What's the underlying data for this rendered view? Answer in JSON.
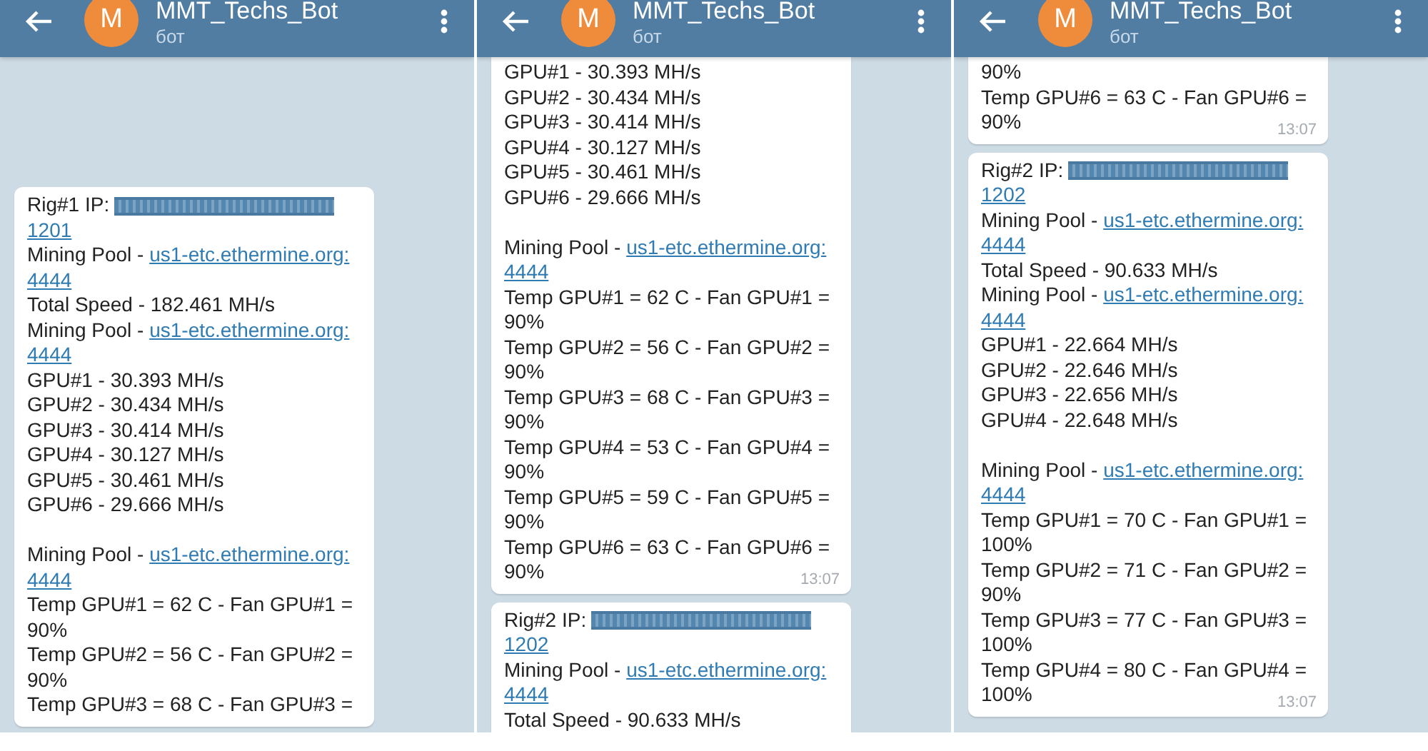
{
  "panels": [
    {
      "header": {
        "title": "MMT_Techs_Bot",
        "subtitle": "бот",
        "avatar": "M"
      },
      "messages": [
        {
          "top_cut": false,
          "lines": [
            {
              "kind": "text",
              "segments": [
                {
                  "kind": "plain",
                  "text": "Rig#1 IP: "
                },
                {
                  "kind": "redacted"
                }
              ]
            },
            {
              "kind": "text",
              "segments": [
                {
                  "kind": "link",
                  "text": "1201"
                }
              ]
            },
            {
              "kind": "text",
              "segments": [
                {
                  "kind": "plain",
                  "text": "Mining Pool - "
                },
                {
                  "kind": "link",
                  "text": "us1-etc.ethermine.org:"
                }
              ]
            },
            {
              "kind": "text",
              "segments": [
                {
                  "kind": "link",
                  "text": "4444"
                }
              ]
            },
            {
              "kind": "text",
              "segments": [
                {
                  "kind": "plain",
                  "text": "Total Speed - 182.461 MH/s"
                }
              ]
            },
            {
              "kind": "text",
              "segments": [
                {
                  "kind": "plain",
                  "text": "Mining Pool - "
                },
                {
                  "kind": "link",
                  "text": "us1-etc.ethermine.org:"
                }
              ]
            },
            {
              "kind": "text",
              "segments": [
                {
                  "kind": "link",
                  "text": "4444"
                }
              ]
            },
            {
              "kind": "text",
              "segments": [
                {
                  "kind": "plain",
                  "text": "GPU#1 - 30.393 MH/s"
                }
              ]
            },
            {
              "kind": "text",
              "segments": [
                {
                  "kind": "plain",
                  "text": "GPU#2 - 30.434 MH/s"
                }
              ]
            },
            {
              "kind": "text",
              "segments": [
                {
                  "kind": "plain",
                  "text": "GPU#3 - 30.414 MH/s"
                }
              ]
            },
            {
              "kind": "text",
              "segments": [
                {
                  "kind": "plain",
                  "text": "GPU#4 - 30.127 MH/s"
                }
              ]
            },
            {
              "kind": "text",
              "segments": [
                {
                  "kind": "plain",
                  "text": "GPU#5 - 30.461 MH/s"
                }
              ]
            },
            {
              "kind": "text",
              "segments": [
                {
                  "kind": "plain",
                  "text": "GPU#6 - 29.666 MH/s"
                }
              ]
            },
            {
              "kind": "blank"
            },
            {
              "kind": "text",
              "segments": [
                {
                  "kind": "plain",
                  "text": "Mining Pool - "
                },
                {
                  "kind": "link",
                  "text": "us1-etc.ethermine.org:"
                }
              ]
            },
            {
              "kind": "text",
              "segments": [
                {
                  "kind": "link",
                  "text": "4444"
                }
              ]
            },
            {
              "kind": "text",
              "segments": [
                {
                  "kind": "plain",
                  "text": "Temp GPU#1 = 62 C - Fan GPU#1 ="
                }
              ]
            },
            {
              "kind": "text",
              "segments": [
                {
                  "kind": "plain",
                  "text": "90%"
                }
              ]
            },
            {
              "kind": "text",
              "segments": [
                {
                  "kind": "plain",
                  "text": "Temp GPU#2 = 56 C - Fan GPU#2 ="
                }
              ]
            },
            {
              "kind": "text",
              "segments": [
                {
                  "kind": "plain",
                  "text": "90%"
                }
              ]
            },
            {
              "kind": "text",
              "segments": [
                {
                  "kind": "plain",
                  "text": "Temp GPU#3 = 68 C - Fan GPU#3 ="
                }
              ]
            }
          ]
        }
      ]
    },
    {
      "header": {
        "title": "MMT_Techs_Bot",
        "subtitle": "бот",
        "avatar": "M"
      },
      "messages": [
        {
          "top_cut": true,
          "time": "13:07",
          "lines": [
            {
              "kind": "text",
              "segments": [
                {
                  "kind": "plain",
                  "text": "GPU#1 - 30.393 MH/s"
                }
              ]
            },
            {
              "kind": "text",
              "segments": [
                {
                  "kind": "plain",
                  "text": "GPU#2 - 30.434 MH/s"
                }
              ]
            },
            {
              "kind": "text",
              "segments": [
                {
                  "kind": "plain",
                  "text": "GPU#3 - 30.414 MH/s"
                }
              ]
            },
            {
              "kind": "text",
              "segments": [
                {
                  "kind": "plain",
                  "text": "GPU#4 - 30.127 MH/s"
                }
              ]
            },
            {
              "kind": "text",
              "segments": [
                {
                  "kind": "plain",
                  "text": "GPU#5 - 30.461 MH/s"
                }
              ]
            },
            {
              "kind": "text",
              "segments": [
                {
                  "kind": "plain",
                  "text": "GPU#6 - 29.666 MH/s"
                }
              ]
            },
            {
              "kind": "blank"
            },
            {
              "kind": "text",
              "segments": [
                {
                  "kind": "plain",
                  "text": "Mining Pool - "
                },
                {
                  "kind": "link",
                  "text": "us1-etc.ethermine.org:"
                }
              ]
            },
            {
              "kind": "text",
              "segments": [
                {
                  "kind": "link",
                  "text": "4444"
                }
              ]
            },
            {
              "kind": "text",
              "segments": [
                {
                  "kind": "plain",
                  "text": "Temp GPU#1 = 62 C - Fan GPU#1 ="
                }
              ]
            },
            {
              "kind": "text",
              "segments": [
                {
                  "kind": "plain",
                  "text": "90%"
                }
              ]
            },
            {
              "kind": "text",
              "segments": [
                {
                  "kind": "plain",
                  "text": "Temp GPU#2 = 56 C - Fan GPU#2 ="
                }
              ]
            },
            {
              "kind": "text",
              "segments": [
                {
                  "kind": "plain",
                  "text": "90%"
                }
              ]
            },
            {
              "kind": "text",
              "segments": [
                {
                  "kind": "plain",
                  "text": "Temp GPU#3 = 68 C - Fan GPU#3 ="
                }
              ]
            },
            {
              "kind": "text",
              "segments": [
                {
                  "kind": "plain",
                  "text": "90%"
                }
              ]
            },
            {
              "kind": "text",
              "segments": [
                {
                  "kind": "plain",
                  "text": "Temp GPU#4 = 53 C - Fan GPU#4 ="
                }
              ]
            },
            {
              "kind": "text",
              "segments": [
                {
                  "kind": "plain",
                  "text": "90%"
                }
              ]
            },
            {
              "kind": "text",
              "segments": [
                {
                  "kind": "plain",
                  "text": "Temp GPU#5 = 59 C - Fan GPU#5 ="
                }
              ]
            },
            {
              "kind": "text",
              "segments": [
                {
                  "kind": "plain",
                  "text": "90%"
                }
              ]
            },
            {
              "kind": "text",
              "segments": [
                {
                  "kind": "plain",
                  "text": "Temp GPU#6 = 63 C - Fan GPU#6 ="
                }
              ]
            },
            {
              "kind": "text",
              "segments": [
                {
                  "kind": "plain",
                  "text": "90%"
                }
              ]
            }
          ]
        },
        {
          "top_cut": false,
          "lines": [
            {
              "kind": "text",
              "segments": [
                {
                  "kind": "plain",
                  "text": "Rig#2 IP: "
                },
                {
                  "kind": "redacted"
                }
              ]
            },
            {
              "kind": "text",
              "segments": [
                {
                  "kind": "link",
                  "text": "1202"
                }
              ]
            },
            {
              "kind": "text",
              "segments": [
                {
                  "kind": "plain",
                  "text": "Mining Pool - "
                },
                {
                  "kind": "link",
                  "text": "us1-etc.ethermine.org:"
                }
              ]
            },
            {
              "kind": "text",
              "segments": [
                {
                  "kind": "link",
                  "text": "4444"
                }
              ]
            },
            {
              "kind": "text",
              "segments": [
                {
                  "kind": "plain",
                  "text": "Total Speed - 90.633 MH/s"
                }
              ]
            }
          ]
        }
      ]
    },
    {
      "header": {
        "title": "MMT_Techs_Bot",
        "subtitle": "бот",
        "avatar": "M"
      },
      "messages": [
        {
          "top_cut": true,
          "time": "13:07",
          "lines": [
            {
              "kind": "text",
              "segments": [
                {
                  "kind": "plain",
                  "text": "90%"
                }
              ]
            },
            {
              "kind": "text",
              "segments": [
                {
                  "kind": "plain",
                  "text": "Temp GPU#6 = 63 C - Fan GPU#6 ="
                }
              ]
            },
            {
              "kind": "text",
              "segments": [
                {
                  "kind": "plain",
                  "text": "90%"
                }
              ]
            }
          ]
        },
        {
          "top_cut": false,
          "time": "13:07",
          "lines": [
            {
              "kind": "text",
              "segments": [
                {
                  "kind": "plain",
                  "text": "Rig#2 IP: "
                },
                {
                  "kind": "redacted"
                }
              ]
            },
            {
              "kind": "text",
              "segments": [
                {
                  "kind": "link",
                  "text": "1202"
                }
              ]
            },
            {
              "kind": "text",
              "segments": [
                {
                  "kind": "plain",
                  "text": "Mining Pool - "
                },
                {
                  "kind": "link",
                  "text": "us1-etc.ethermine.org:"
                }
              ]
            },
            {
              "kind": "text",
              "segments": [
                {
                  "kind": "link",
                  "text": "4444"
                }
              ]
            },
            {
              "kind": "text",
              "segments": [
                {
                  "kind": "plain",
                  "text": "Total Speed - 90.633 MH/s"
                }
              ]
            },
            {
              "kind": "text",
              "segments": [
                {
                  "kind": "plain",
                  "text": "Mining Pool - "
                },
                {
                  "kind": "link",
                  "text": "us1-etc.ethermine.org:"
                }
              ]
            },
            {
              "kind": "text",
              "segments": [
                {
                  "kind": "link",
                  "text": "4444"
                }
              ]
            },
            {
              "kind": "text",
              "segments": [
                {
                  "kind": "plain",
                  "text": "GPU#1 - 22.664 MH/s"
                }
              ]
            },
            {
              "kind": "text",
              "segments": [
                {
                  "kind": "plain",
                  "text": "GPU#2 - 22.646 MH/s"
                }
              ]
            },
            {
              "kind": "text",
              "segments": [
                {
                  "kind": "plain",
                  "text": "GPU#3 - 22.656 MH/s"
                }
              ]
            },
            {
              "kind": "text",
              "segments": [
                {
                  "kind": "plain",
                  "text": "GPU#4 - 22.648 MH/s"
                }
              ]
            },
            {
              "kind": "blank"
            },
            {
              "kind": "text",
              "segments": [
                {
                  "kind": "plain",
                  "text": "Mining Pool - "
                },
                {
                  "kind": "link",
                  "text": "us1-etc.ethermine.org:"
                }
              ]
            },
            {
              "kind": "text",
              "segments": [
                {
                  "kind": "link",
                  "text": "4444"
                }
              ]
            },
            {
              "kind": "text",
              "segments": [
                {
                  "kind": "plain",
                  "text": "Temp GPU#1 = 70 C - Fan GPU#1 ="
                }
              ]
            },
            {
              "kind": "text",
              "segments": [
                {
                  "kind": "plain",
                  "text": "100%"
                }
              ]
            },
            {
              "kind": "text",
              "segments": [
                {
                  "kind": "plain",
                  "text": "Temp GPU#2 = 71 C - Fan GPU#2 ="
                }
              ]
            },
            {
              "kind": "text",
              "segments": [
                {
                  "kind": "plain",
                  "text": "90%"
                }
              ]
            },
            {
              "kind": "text",
              "segments": [
                {
                  "kind": "plain",
                  "text": "Temp GPU#3 = 77 C - Fan GPU#3 ="
                }
              ]
            },
            {
              "kind": "text",
              "segments": [
                {
                  "kind": "plain",
                  "text": "100%"
                }
              ]
            },
            {
              "kind": "text",
              "segments": [
                {
                  "kind": "plain",
                  "text": "Temp GPU#4 = 80 C - Fan GPU#4 ="
                }
              ]
            },
            {
              "kind": "text",
              "segments": [
                {
                  "kind": "plain",
                  "text": "100%"
                }
              ]
            }
          ]
        }
      ]
    }
  ]
}
